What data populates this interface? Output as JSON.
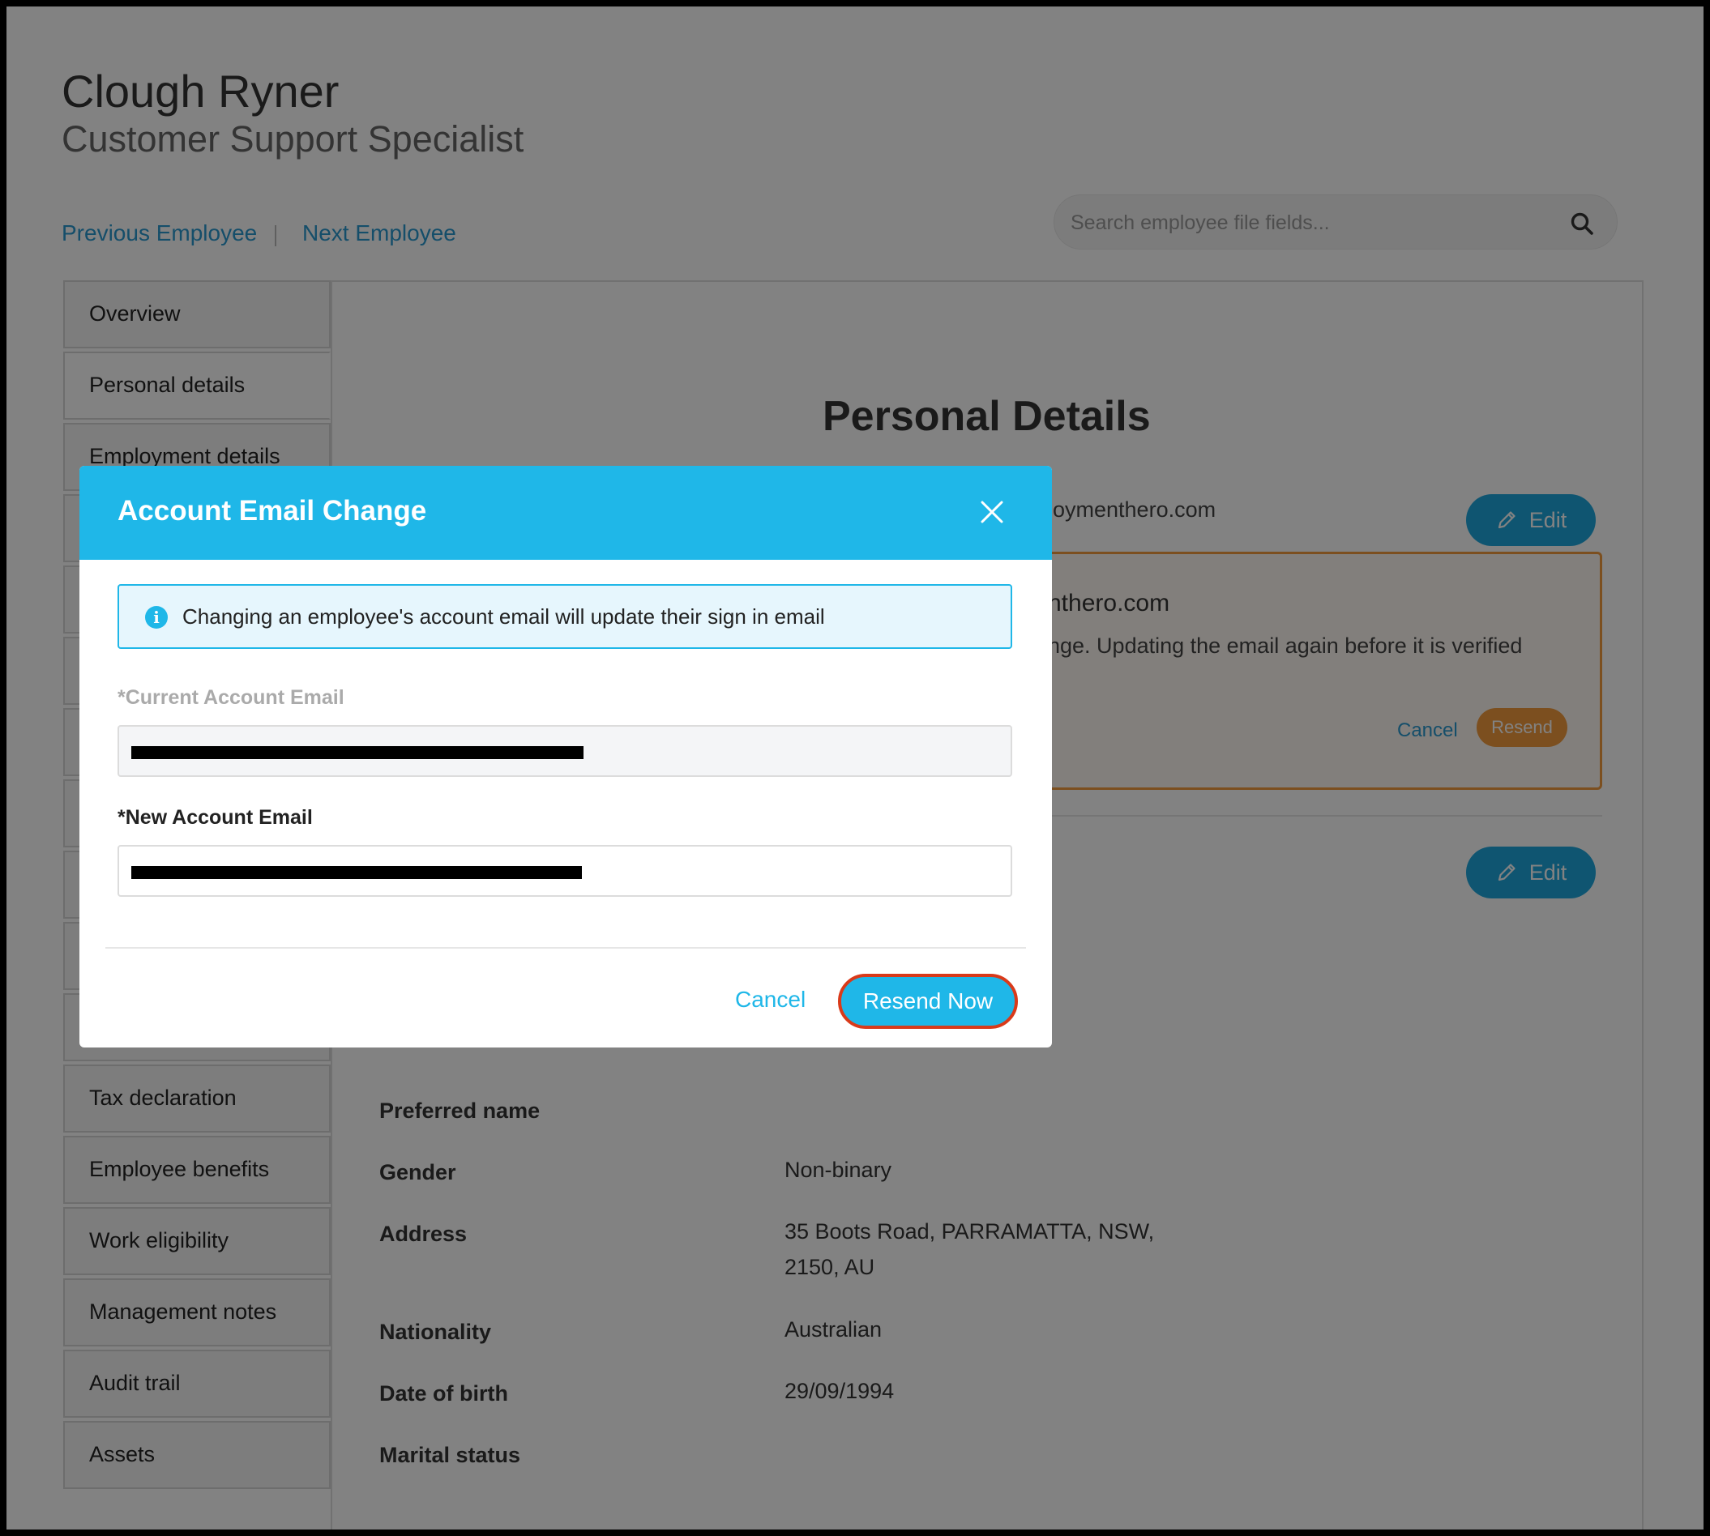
{
  "employee": {
    "name": "Clough Ryner",
    "title": "Customer Support Specialist"
  },
  "nav": {
    "previous": "Previous Employee",
    "next": "Next Employee"
  },
  "search": {
    "placeholder": "Search employee file fields..."
  },
  "sidebar": {
    "items": [
      {
        "label": "Overview"
      },
      {
        "label": "Personal details"
      },
      {
        "label": "Employment details"
      },
      {
        "label": "Tax declaration"
      },
      {
        "label": "Employee benefits"
      },
      {
        "label": "Work eligibility"
      },
      {
        "label": "Management notes"
      },
      {
        "label": "Audit trail"
      },
      {
        "label": "Assets"
      }
    ]
  },
  "content": {
    "section_title": "Personal Details",
    "email_partial": "loymenthero.com",
    "edit_label": "Edit",
    "pending": {
      "email_partial": "nthero.com",
      "message_partial": "nge. Updating the email again before it is verified",
      "cancel": "Cancel",
      "resend": "Resend"
    },
    "fields": [
      {
        "label": "Preferred name",
        "value": ""
      },
      {
        "label": "Gender",
        "value": "Non-binary"
      },
      {
        "label": "Address",
        "value": "35 Boots Road, PARRAMATTA, NSW,\n2150, AU"
      },
      {
        "label": "Nationality",
        "value": "Australian"
      },
      {
        "label": "Date of birth",
        "value": "29/09/1994"
      },
      {
        "label": "Marital status",
        "value": ""
      }
    ]
  },
  "modal": {
    "title": "Account Email Change",
    "info": "Changing an employee's account email will update their sign in email",
    "current_label": "*Current Account Email",
    "new_label": "*New Account Email",
    "cancel": "Cancel",
    "resend_now": "Resend Now"
  },
  "colors": {
    "accent": "#1fb7e8",
    "link": "#2a9ad0",
    "warning": "#f39c3d",
    "highlight_border": "#d93a1a"
  }
}
